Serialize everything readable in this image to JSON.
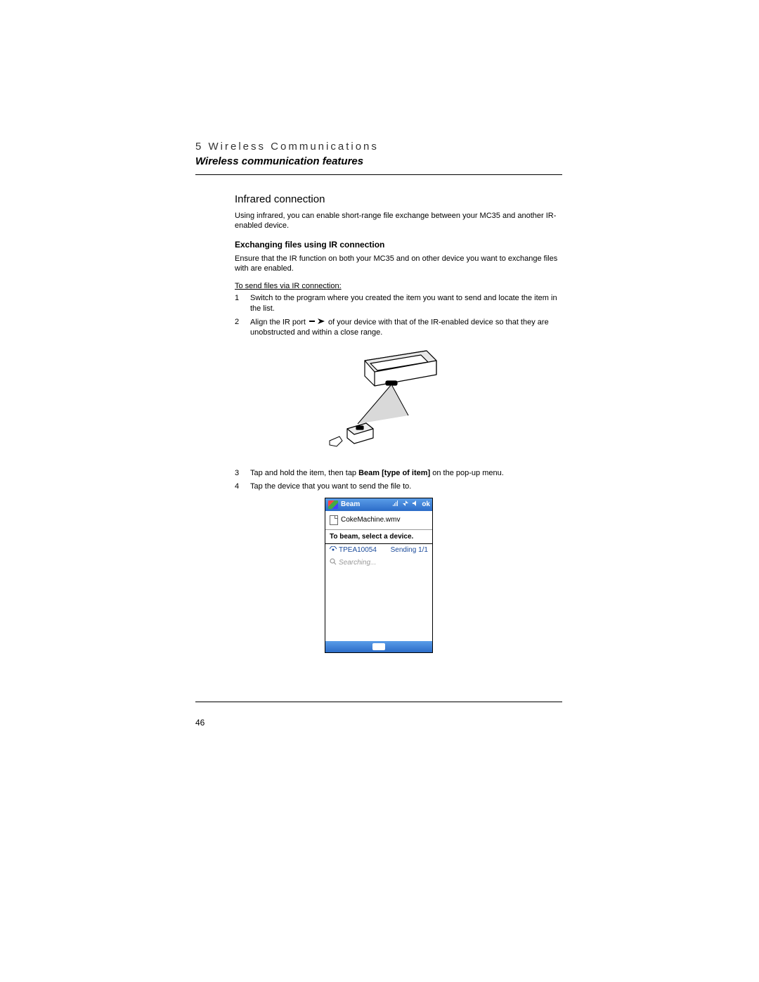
{
  "header": {
    "chapter": "5 Wireless Communications",
    "subtitle": "Wireless communication features"
  },
  "section": {
    "title": "Infrared connection",
    "intro": "Using infrared, you can enable short-range file exchange between your MC35 and another IR-enabled device.",
    "subheading": "Exchanging files using IR connection",
    "subintro": "Ensure that the IR function on both your MC35 and on other device you want to exchange files with are enabled.",
    "procedure_title": "To send files via IR connection:",
    "steps": [
      {
        "n": "1",
        "text": "Switch to the program where you created the item you want to send and locate the item in the list."
      },
      {
        "n": "2",
        "pre": "Align the IR port ",
        "post": " of your device with that of the IR-enabled device so that they are unobstructed and within a close range."
      },
      {
        "n": "3",
        "pre": "Tap and hold the item, then tap ",
        "bold": "Beam [type of item]",
        "post": " on the pop-up menu."
      },
      {
        "n": "4",
        "text": "Tap the device that you want to send the file to."
      }
    ]
  },
  "device_shot": {
    "title": "Beam",
    "ok": "ok",
    "filename": "CokeMachine.wmv",
    "header": "To beam, select a device.",
    "rows": [
      {
        "name": "TPEA10054",
        "status": "Sending 1/1"
      }
    ],
    "searching": "Searching..."
  },
  "page_number": "46"
}
